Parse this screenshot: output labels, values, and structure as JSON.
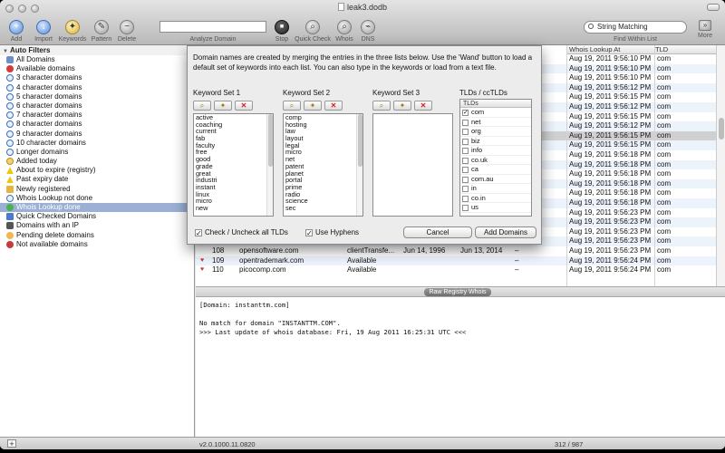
{
  "window": {
    "title": "leak3.dodb"
  },
  "toolbar": {
    "add": "Add",
    "import": "Import",
    "keywords": "Keywords",
    "pattern": "Pattern",
    "delete": "Delete",
    "analyze_domain": "Analyze Domain",
    "stop": "Stop",
    "quick_check": "Quick Check",
    "whois": "Whois",
    "dns": "DNS",
    "search_value": "String Matching",
    "find_within_list": "Find Within List",
    "more": "More"
  },
  "sidebar": {
    "header": "Auto Filters",
    "items": [
      {
        "label": "All Domains",
        "icon": "domains-icon"
      },
      {
        "label": "Available domains",
        "icon": "heart-icon"
      },
      {
        "label": "3 character domains",
        "icon": "magnifier-icon"
      },
      {
        "label": "4 character domains",
        "icon": "magnifier-icon"
      },
      {
        "label": "5 character domains",
        "icon": "magnifier-icon"
      },
      {
        "label": "6 character domains",
        "icon": "magnifier-icon"
      },
      {
        "label": "7 character domains",
        "icon": "magnifier-icon"
      },
      {
        "label": "8 character domains",
        "icon": "magnifier-icon"
      },
      {
        "label": "9 character domains",
        "icon": "magnifier-icon"
      },
      {
        "label": "10 character domains",
        "icon": "magnifier-icon"
      },
      {
        "label": "Longer domains",
        "icon": "magnifier-icon"
      },
      {
        "label": "Added today",
        "icon": "clock-icon"
      },
      {
        "label": "About to expire (registry)",
        "icon": "warning-icon"
      },
      {
        "label": "Past expiry date",
        "icon": "warning-icon"
      },
      {
        "label": "Newly registered",
        "icon": "new-icon"
      },
      {
        "label": "Whois Lookup not done",
        "icon": "magnifier-icon"
      },
      {
        "label": "Whois Lookup done",
        "icon": "check-icon"
      },
      {
        "label": "Quick Checked Domains",
        "icon": "quick-check-icon"
      },
      {
        "label": "Domains with an IP",
        "icon": "ip-icon"
      },
      {
        "label": "Pending delete domains",
        "icon": "pending-icon"
      },
      {
        "label": "Not available domains",
        "icon": "not-available-icon"
      }
    ]
  },
  "table": {
    "headers": {
      "whois_lookup_at": "Whois Lookup At",
      "tld": "TLD"
    },
    "right_rows": [
      {
        "date": "Aug 19, 2011 9:56:10 PM",
        "tld": "com"
      },
      {
        "date": "Aug 19, 2011 9:56:10 PM",
        "tld": "com"
      },
      {
        "date": "Aug 19, 2011 9:56:10 PM",
        "tld": "com"
      },
      {
        "date": "Aug 19, 2011 9:56:12 PM",
        "tld": "com"
      },
      {
        "date": "Aug 19, 2011 9:56:15 PM",
        "tld": "com"
      },
      {
        "date": "Aug 19, 2011 9:56:12 PM",
        "tld": "com"
      },
      {
        "date": "Aug 19, 2011 9:56:15 PM",
        "tld": "com"
      },
      {
        "date": "Aug 19, 2011 9:56:12 PM",
        "tld": "com"
      },
      {
        "date": "Aug 19, 2011 9:56:15 PM",
        "tld": "com"
      },
      {
        "date": "Aug 19, 2011 9:56:15 PM",
        "tld": "com"
      },
      {
        "date": "Aug 19, 2011 9:56:18 PM",
        "tld": "com"
      },
      {
        "date": "Aug 19, 2011 9:56:18 PM",
        "tld": "com"
      },
      {
        "date": "Aug 19, 2011 9:56:18 PM",
        "tld": "com"
      },
      {
        "date": "Aug 19, 2011 9:56:18 PM",
        "tld": "com"
      },
      {
        "date": "Aug 19, 2011 9:56:18 PM",
        "tld": "com"
      },
      {
        "date": "Aug 19, 2011 9:56:18 PM",
        "tld": "com"
      },
      {
        "date": "Aug 19, 2011 9:56:23 PM",
        "tld": "com"
      },
      {
        "date": "Aug 19, 2011 9:56:23 PM",
        "tld": "com"
      },
      {
        "date": "Aug 19, 2011 9:56:23 PM",
        "tld": "com"
      },
      {
        "date": "Aug 19, 2011 9:56:23 PM",
        "tld": "com"
      }
    ],
    "full_rows": [
      {
        "num": "108",
        "domain": "opensoftware.com",
        "status": "clientTransfe...",
        "created": "Jun 14, 1996",
        "expires": "Jun 13, 2014",
        "dash": "–",
        "date": "Aug 19, 2011 9:56:23 PM",
        "tld": "com",
        "available": false
      },
      {
        "num": "109",
        "domain": "opentrademark.com",
        "status": "Available",
        "created": "",
        "expires": "",
        "dash": "–",
        "date": "Aug 19, 2011 9:56:24 PM",
        "tld": "com",
        "available": true
      },
      {
        "num": "110",
        "domain": "picocomp.com",
        "status": "Available",
        "created": "",
        "expires": "",
        "dash": "–",
        "date": "Aug 19, 2011 9:56:24 PM",
        "tld": "com",
        "available": true
      }
    ]
  },
  "raw_registry_label": "Raw Registry Whois",
  "whois_output": [
    "[Domain: instanttm.com]",
    "",
    "No match for domain \"INSTANTTM.COM\".",
    ">>> Last update of whois database: Fri, 19 Aug 2011 16:25:31 UTC <<<"
  ],
  "status": {
    "version": "v2.0.1000.11.0820",
    "count": "312 / 987"
  },
  "sheet": {
    "intro": "Domain names are created by merging the entries in the three lists below. Use the 'Wand' button to load a default set of keywords into each list. You can also type in the keywords or load from a text file.",
    "set1_label": "Keyword Set 1",
    "set2_label": "Keyword Set 2",
    "set3_label": "Keyword Set 3",
    "tlds_label": "TLDs / ccTLDs",
    "tlds_header": "TLDs",
    "set1": [
      "active",
      "coaching",
      "current",
      "fab",
      "faculty",
      "free",
      "good",
      "grade",
      "great",
      "industri",
      "instant",
      "linux",
      "micro",
      "new"
    ],
    "set2": [
      "comp",
      "hosting",
      "law",
      "layout",
      "legal",
      "micro",
      "net",
      "patent",
      "planet",
      "portal",
      "prime",
      "radio",
      "science",
      "sec"
    ],
    "set3": [],
    "tlds": [
      {
        "name": "com",
        "checked": true
      },
      {
        "name": "net",
        "checked": false
      },
      {
        "name": "org",
        "checked": false
      },
      {
        "name": "biz",
        "checked": false
      },
      {
        "name": "info",
        "checked": false
      },
      {
        "name": "co.uk",
        "checked": false
      },
      {
        "name": "ca",
        "checked": false
      },
      {
        "name": "com.au",
        "checked": false
      },
      {
        "name": "in",
        "checked": false
      },
      {
        "name": "co.in",
        "checked": false
      },
      {
        "name": "us",
        "checked": false
      }
    ],
    "check_all_label": "Check / Uncheck all TLDs",
    "hyphens_label": "Use Hyphens",
    "cancel": "Cancel",
    "add_domains": "Add Domains"
  }
}
